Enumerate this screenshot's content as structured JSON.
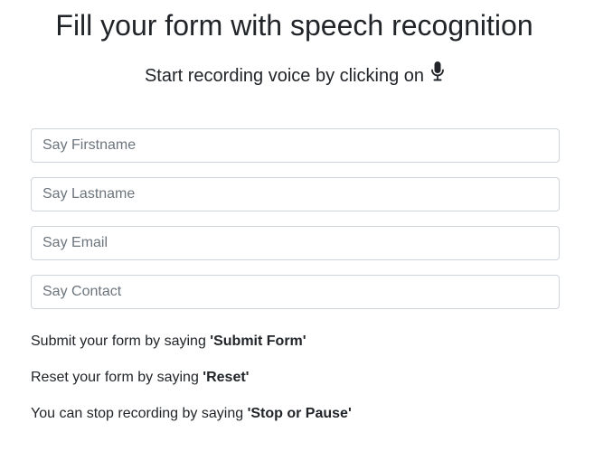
{
  "header": {
    "title": "Fill your form with speech recognition",
    "subtitle": "Start recording voice by clicking on",
    "mic_icon": "microphone-icon"
  },
  "form": {
    "fields": [
      {
        "name": "firstname",
        "value": "",
        "placeholder": "Say Firstname"
      },
      {
        "name": "lastname",
        "value": "",
        "placeholder": "Say Lastname"
      },
      {
        "name": "email",
        "value": "",
        "placeholder": "Say Email"
      },
      {
        "name": "contact",
        "value": "",
        "placeholder": "Say Contact"
      }
    ]
  },
  "instructions": [
    {
      "text": "Submit your form by saying ",
      "command": "'Submit Form'"
    },
    {
      "text": "Reset your form by saying ",
      "command": "'Reset'"
    },
    {
      "text": "You can stop recording by saying ",
      "command": "'Stop or Pause'"
    }
  ],
  "colors": {
    "text": "#212529",
    "input_border": "#ced4da",
    "placeholder": "#6c757d"
  }
}
